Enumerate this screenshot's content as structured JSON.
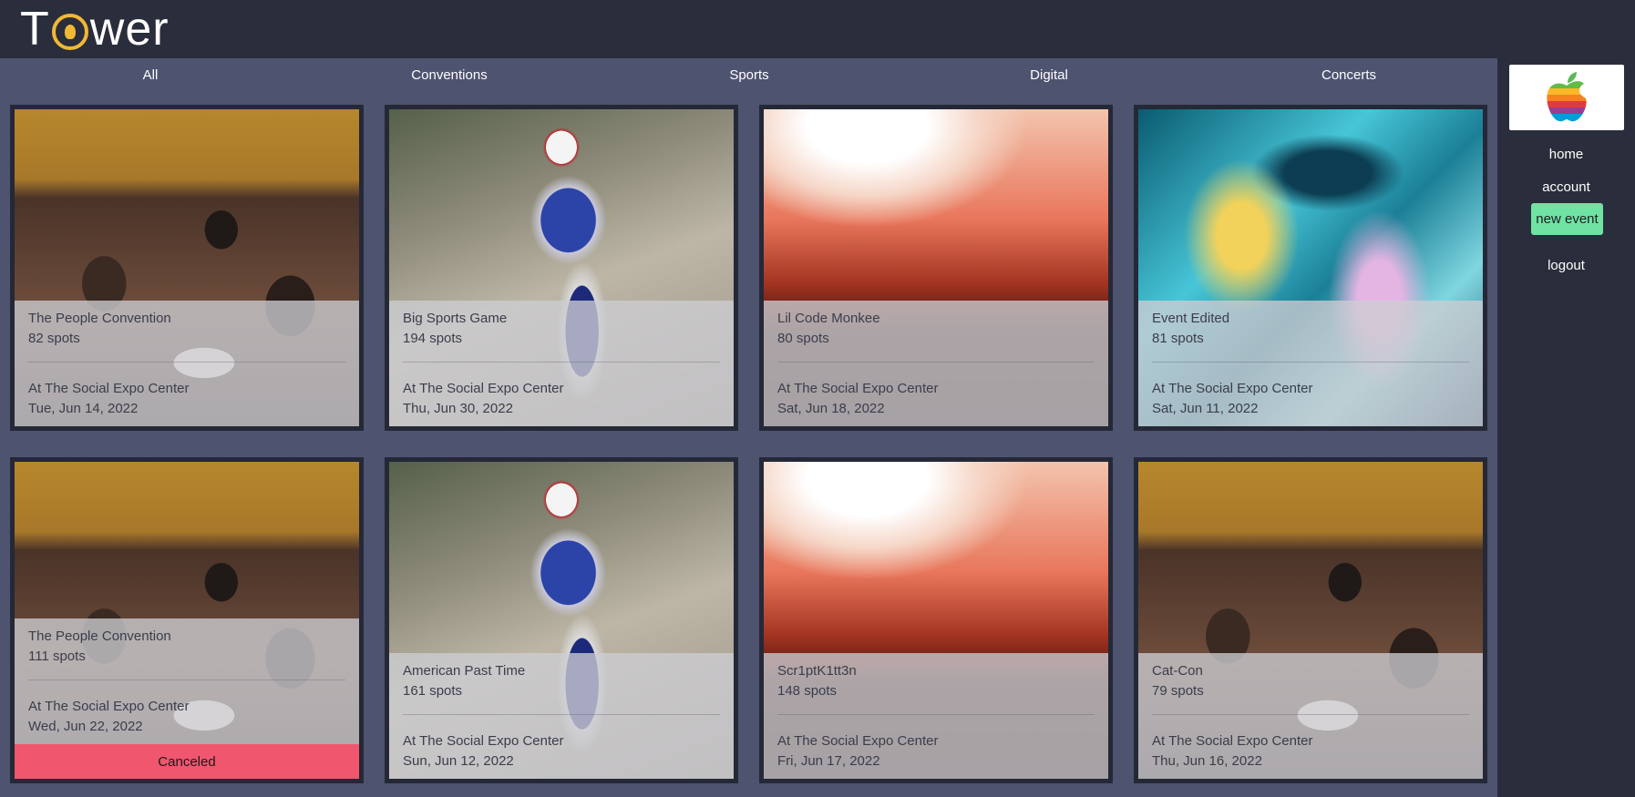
{
  "app": {
    "logo_text_prefix": "T",
    "logo_text_suffix": "wer"
  },
  "categories": [
    "All",
    "Conventions",
    "Sports",
    "Digital",
    "Concerts"
  ],
  "sidebar": {
    "brand_icon": "apple-rainbow-logo",
    "home": "home",
    "account": "account",
    "new_event": "new event",
    "logout": "logout"
  },
  "events": [
    {
      "name": "The People Convention",
      "spots": "82 spots",
      "location": "At The Social Expo Center",
      "date": "Tue, Jun 14, 2022",
      "image": "convention"
    },
    {
      "name": "Big Sports Game",
      "spots": "194 spots",
      "location": "At The Social Expo Center",
      "date": "Thu, Jun 30, 2022",
      "image": "sports"
    },
    {
      "name": "Lil Code Monkee",
      "spots": "80 spots",
      "location": "At The Social Expo Center",
      "date": "Sat, Jun 18, 2022",
      "image": "concert"
    },
    {
      "name": "Event Edited",
      "spots": "81 spots",
      "location": "At The Social Expo Center",
      "date": "Sat, Jun 11, 2022",
      "image": "digital"
    },
    {
      "name": "The People Convention",
      "spots": "111 spots",
      "location": "At The Social Expo Center",
      "date": "Wed, Jun 22, 2022",
      "image": "convention",
      "status": "Canceled"
    },
    {
      "name": "American Past Time",
      "spots": "161 spots",
      "location": "At The Social Expo Center",
      "date": "Sun, Jun 12, 2022",
      "image": "sports"
    },
    {
      "name": "Scr1ptK1tt3n",
      "spots": "148 spots",
      "location": "At The Social Expo Center",
      "date": "Fri, Jun 17, 2022",
      "image": "concert"
    },
    {
      "name": "Cat-Con",
      "spots": "79 spots",
      "location": "At The Social Expo Center",
      "date": "Thu, Jun 16, 2022",
      "image": "convention"
    }
  ],
  "colors": {
    "header_bg": "#2a2d3b",
    "main_bg": "#4e5370",
    "accent_green": "#6fe3a2",
    "canceled_red": "#f0566e",
    "logo_gold": "#f0b935"
  }
}
